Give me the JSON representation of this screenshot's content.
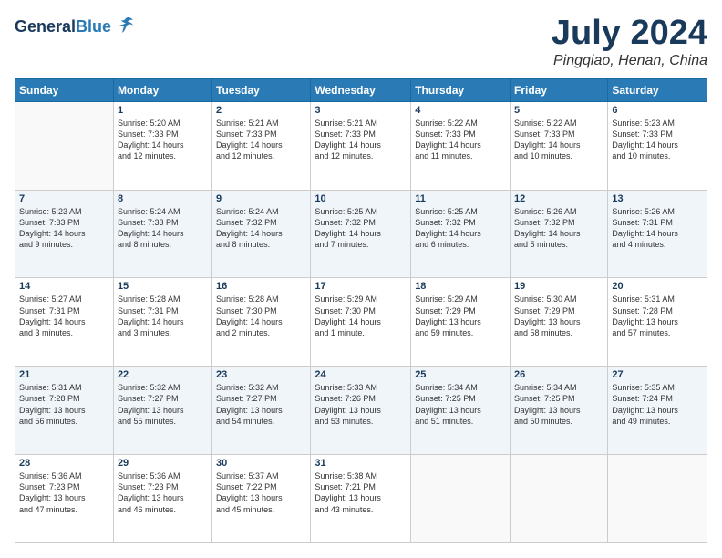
{
  "header": {
    "logo_line1": "General",
    "logo_line2": "Blue",
    "month": "July 2024",
    "location": "Pingqiao, Henan, China"
  },
  "weekdays": [
    "Sunday",
    "Monday",
    "Tuesday",
    "Wednesday",
    "Thursday",
    "Friday",
    "Saturday"
  ],
  "weeks": [
    [
      {
        "num": "",
        "info": ""
      },
      {
        "num": "1",
        "info": "Sunrise: 5:20 AM\nSunset: 7:33 PM\nDaylight: 14 hours\nand 12 minutes."
      },
      {
        "num": "2",
        "info": "Sunrise: 5:21 AM\nSunset: 7:33 PM\nDaylight: 14 hours\nand 12 minutes."
      },
      {
        "num": "3",
        "info": "Sunrise: 5:21 AM\nSunset: 7:33 PM\nDaylight: 14 hours\nand 12 minutes."
      },
      {
        "num": "4",
        "info": "Sunrise: 5:22 AM\nSunset: 7:33 PM\nDaylight: 14 hours\nand 11 minutes."
      },
      {
        "num": "5",
        "info": "Sunrise: 5:22 AM\nSunset: 7:33 PM\nDaylight: 14 hours\nand 10 minutes."
      },
      {
        "num": "6",
        "info": "Sunrise: 5:23 AM\nSunset: 7:33 PM\nDaylight: 14 hours\nand 10 minutes."
      }
    ],
    [
      {
        "num": "7",
        "info": "Sunrise: 5:23 AM\nSunset: 7:33 PM\nDaylight: 14 hours\nand 9 minutes."
      },
      {
        "num": "8",
        "info": "Sunrise: 5:24 AM\nSunset: 7:33 PM\nDaylight: 14 hours\nand 8 minutes."
      },
      {
        "num": "9",
        "info": "Sunrise: 5:24 AM\nSunset: 7:32 PM\nDaylight: 14 hours\nand 8 minutes."
      },
      {
        "num": "10",
        "info": "Sunrise: 5:25 AM\nSunset: 7:32 PM\nDaylight: 14 hours\nand 7 minutes."
      },
      {
        "num": "11",
        "info": "Sunrise: 5:25 AM\nSunset: 7:32 PM\nDaylight: 14 hours\nand 6 minutes."
      },
      {
        "num": "12",
        "info": "Sunrise: 5:26 AM\nSunset: 7:32 PM\nDaylight: 14 hours\nand 5 minutes."
      },
      {
        "num": "13",
        "info": "Sunrise: 5:26 AM\nSunset: 7:31 PM\nDaylight: 14 hours\nand 4 minutes."
      }
    ],
    [
      {
        "num": "14",
        "info": "Sunrise: 5:27 AM\nSunset: 7:31 PM\nDaylight: 14 hours\nand 3 minutes."
      },
      {
        "num": "15",
        "info": "Sunrise: 5:28 AM\nSunset: 7:31 PM\nDaylight: 14 hours\nand 3 minutes."
      },
      {
        "num": "16",
        "info": "Sunrise: 5:28 AM\nSunset: 7:30 PM\nDaylight: 14 hours\nand 2 minutes."
      },
      {
        "num": "17",
        "info": "Sunrise: 5:29 AM\nSunset: 7:30 PM\nDaylight: 14 hours\nand 1 minute."
      },
      {
        "num": "18",
        "info": "Sunrise: 5:29 AM\nSunset: 7:29 PM\nDaylight: 13 hours\nand 59 minutes."
      },
      {
        "num": "19",
        "info": "Sunrise: 5:30 AM\nSunset: 7:29 PM\nDaylight: 13 hours\nand 58 minutes."
      },
      {
        "num": "20",
        "info": "Sunrise: 5:31 AM\nSunset: 7:28 PM\nDaylight: 13 hours\nand 57 minutes."
      }
    ],
    [
      {
        "num": "21",
        "info": "Sunrise: 5:31 AM\nSunset: 7:28 PM\nDaylight: 13 hours\nand 56 minutes."
      },
      {
        "num": "22",
        "info": "Sunrise: 5:32 AM\nSunset: 7:27 PM\nDaylight: 13 hours\nand 55 minutes."
      },
      {
        "num": "23",
        "info": "Sunrise: 5:32 AM\nSunset: 7:27 PM\nDaylight: 13 hours\nand 54 minutes."
      },
      {
        "num": "24",
        "info": "Sunrise: 5:33 AM\nSunset: 7:26 PM\nDaylight: 13 hours\nand 53 minutes."
      },
      {
        "num": "25",
        "info": "Sunrise: 5:34 AM\nSunset: 7:25 PM\nDaylight: 13 hours\nand 51 minutes."
      },
      {
        "num": "26",
        "info": "Sunrise: 5:34 AM\nSunset: 7:25 PM\nDaylight: 13 hours\nand 50 minutes."
      },
      {
        "num": "27",
        "info": "Sunrise: 5:35 AM\nSunset: 7:24 PM\nDaylight: 13 hours\nand 49 minutes."
      }
    ],
    [
      {
        "num": "28",
        "info": "Sunrise: 5:36 AM\nSunset: 7:23 PM\nDaylight: 13 hours\nand 47 minutes."
      },
      {
        "num": "29",
        "info": "Sunrise: 5:36 AM\nSunset: 7:23 PM\nDaylight: 13 hours\nand 46 minutes."
      },
      {
        "num": "30",
        "info": "Sunrise: 5:37 AM\nSunset: 7:22 PM\nDaylight: 13 hours\nand 45 minutes."
      },
      {
        "num": "31",
        "info": "Sunrise: 5:38 AM\nSunset: 7:21 PM\nDaylight: 13 hours\nand 43 minutes."
      },
      {
        "num": "",
        "info": ""
      },
      {
        "num": "",
        "info": ""
      },
      {
        "num": "",
        "info": ""
      }
    ]
  ]
}
